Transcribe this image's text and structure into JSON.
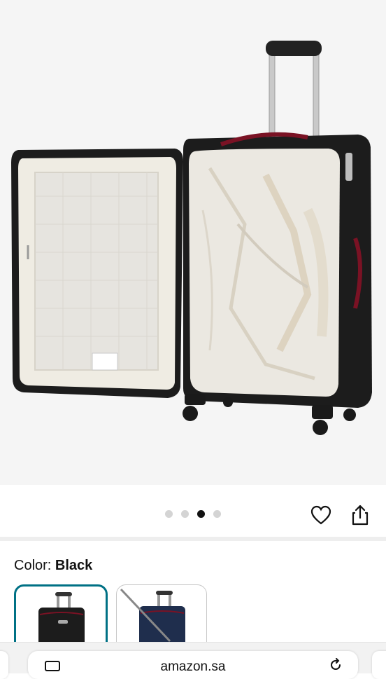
{
  "product_gallery": {
    "image_subject": "open-black-softside-spinner-suitcase",
    "dot_count": 4,
    "active_dot_index": 2
  },
  "actions": {
    "favorite_icon": "heart-icon",
    "share_icon": "share-icon"
  },
  "color_selector": {
    "label": "Color: ",
    "selected_value": "Black",
    "options": [
      {
        "name": "Black",
        "color": "#1a1a1a",
        "selected": true
      },
      {
        "name": "Navy",
        "color": "#1f2e4d",
        "selected": false
      }
    ]
  },
  "browser": {
    "url": "amazon.sa",
    "left_icon": "tab-icon",
    "right_icon": "reload-icon"
  },
  "colors": {
    "accent_selected": "#007185",
    "bag_black": "#1c1c1c",
    "trim_red": "#7a1224",
    "lining": "#efece3"
  }
}
